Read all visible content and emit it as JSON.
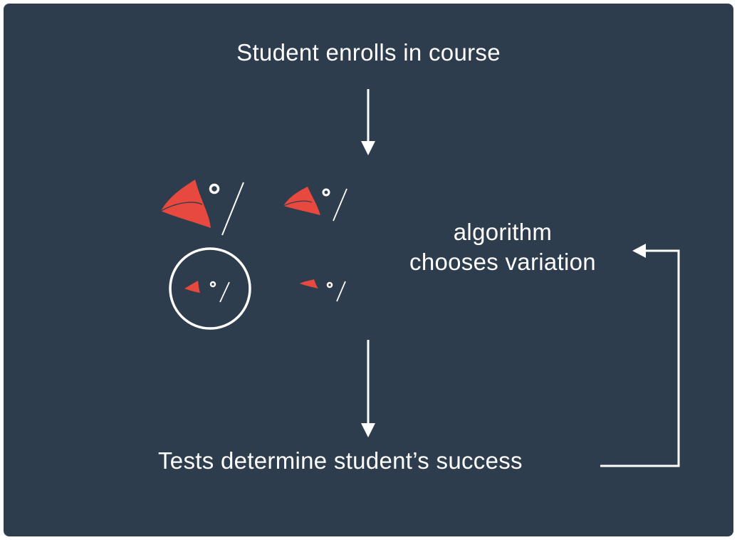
{
  "step_enroll": "Student enrolls in course",
  "algorithm_line1": "algorithm",
  "algorithm_line2": "chooses variation",
  "step_tests": "Tests determine student’s success",
  "colors": {
    "background": "#2e3d4e",
    "foreground": "#ffffff",
    "beak": "#e8493e"
  },
  "icons": [
    "bird-head-icon",
    "bird-head-icon",
    "bird-head-icon",
    "bird-head-icon"
  ],
  "selected_variation": 3
}
